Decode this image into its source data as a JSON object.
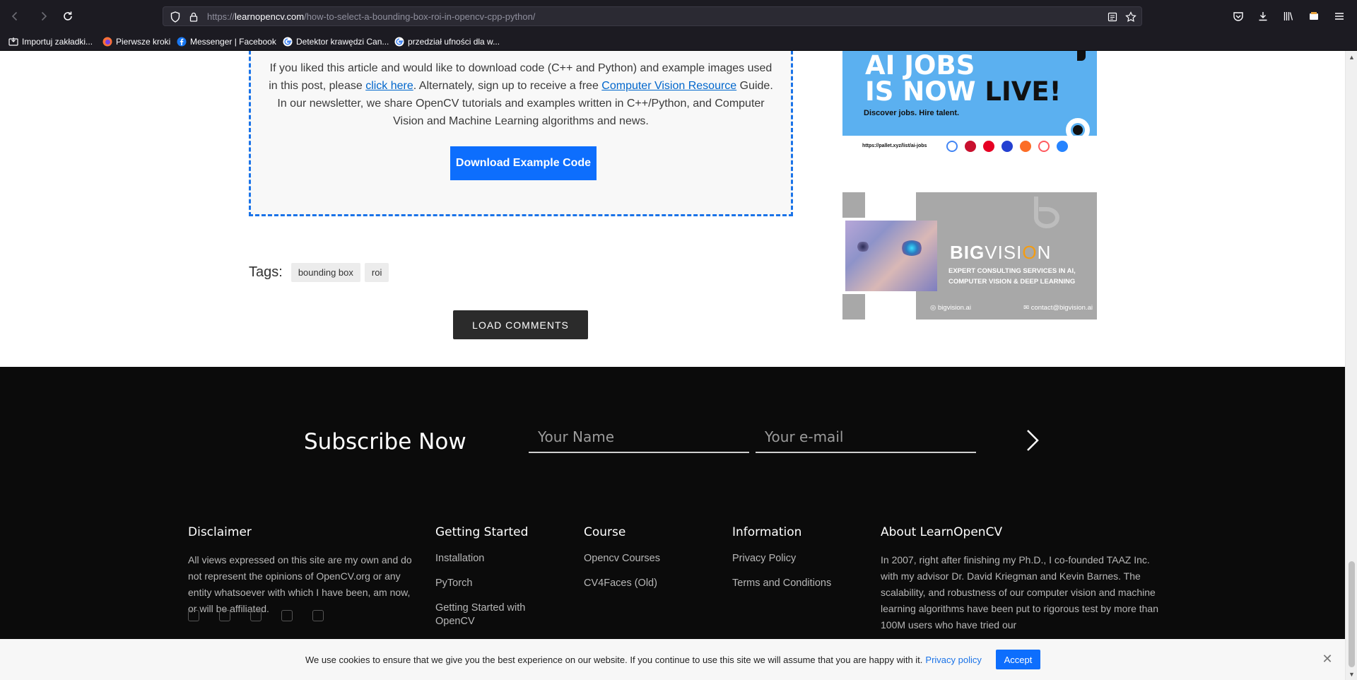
{
  "browser": {
    "url_prefix": "https://",
    "url_host": "learnopencv.com",
    "url_path": "/how-to-select-a-bounding-box-roi-in-opencv-cpp-python/",
    "bookmarks": [
      {
        "label": "Importuj zakładki...",
        "icon": "import-icon"
      },
      {
        "label": "Pierwsze kroki",
        "icon": "firefox-icon"
      },
      {
        "label": "Messenger | Facebook",
        "icon": "facebook-icon"
      },
      {
        "label": "Detektor krawędzi Can...",
        "icon": "google-icon"
      },
      {
        "label": "przedział ufności dla w...",
        "icon": "google-icon"
      }
    ]
  },
  "article": {
    "promo": {
      "text_1": "If you liked this article and would like to download code (C++ and Python) and example images used in this post, please ",
      "link_1": "click here",
      "text_2": ". Alternately, sign up to receive a free ",
      "link_2": "Computer Vision Resource",
      "text_3": " Guide. In our newsletter, we share OpenCV tutorials and examples written in C++/Python, and Computer Vision and Machine Learning algorithms and news.",
      "button": "Download Example Code"
    },
    "tags_label": "Tags:",
    "tags": [
      "bounding box",
      "roi"
    ],
    "load_comments": "LOAD COMMENTS"
  },
  "ads": {
    "ad1": {
      "headline_1": "AI JOBS",
      "headline_2": "IS NOW ",
      "headline_live": "LIVE!",
      "subline": "Discover jobs. Hire talent.",
      "url": "https://pallet.xyz/list/ai-jobs"
    },
    "ad2": {
      "brand_bold": "BIG",
      "brand_rest_1": "VISI",
      "brand_o": "O",
      "brand_rest_2": "N",
      "line_1": "EXPERT CONSULTING SERVICES IN AI,",
      "line_2": "COMPUTER VISION & DEEP LEARNING",
      "website": "bigvision.ai",
      "email": "contact@bigvision.ai"
    }
  },
  "footer": {
    "subscribe_title": "Subscribe Now",
    "name_placeholder": "Your Name",
    "email_placeholder": "Your e-mail",
    "disclaimer": {
      "title": "Disclaimer",
      "text": "All views expressed on this site are my own and do not represent the opinions of OpenCV.org or any entity whatsoever with which I have been, am now, or will be affiliated."
    },
    "getting_started": {
      "title": "Getting Started",
      "links": [
        "Installation",
        "PyTorch",
        "Getting Started with OpenCV"
      ]
    },
    "course": {
      "title": "Course",
      "links": [
        "Opencv Courses",
        "CV4Faces (Old)"
      ]
    },
    "information": {
      "title": "Information",
      "links": [
        "Privacy Policy",
        "Terms and Conditions"
      ]
    },
    "about": {
      "title": "About LearnOpenCV",
      "text": "In 2007, right after finishing my Ph.D., I co-founded TAAZ Inc. with my advisor Dr. David Kriegman and Kevin Barnes. The scalability, and robustness of our computer vision and machine learning algorithms have been put to rigorous test by more than 100M users who have tried our"
    }
  },
  "cookie": {
    "message": "We use cookies to ensure that we give you the best experience on our website. If you continue to use this site we will assume that you are happy with it.",
    "policy_link": "Privacy policy",
    "accept": "Accept"
  }
}
